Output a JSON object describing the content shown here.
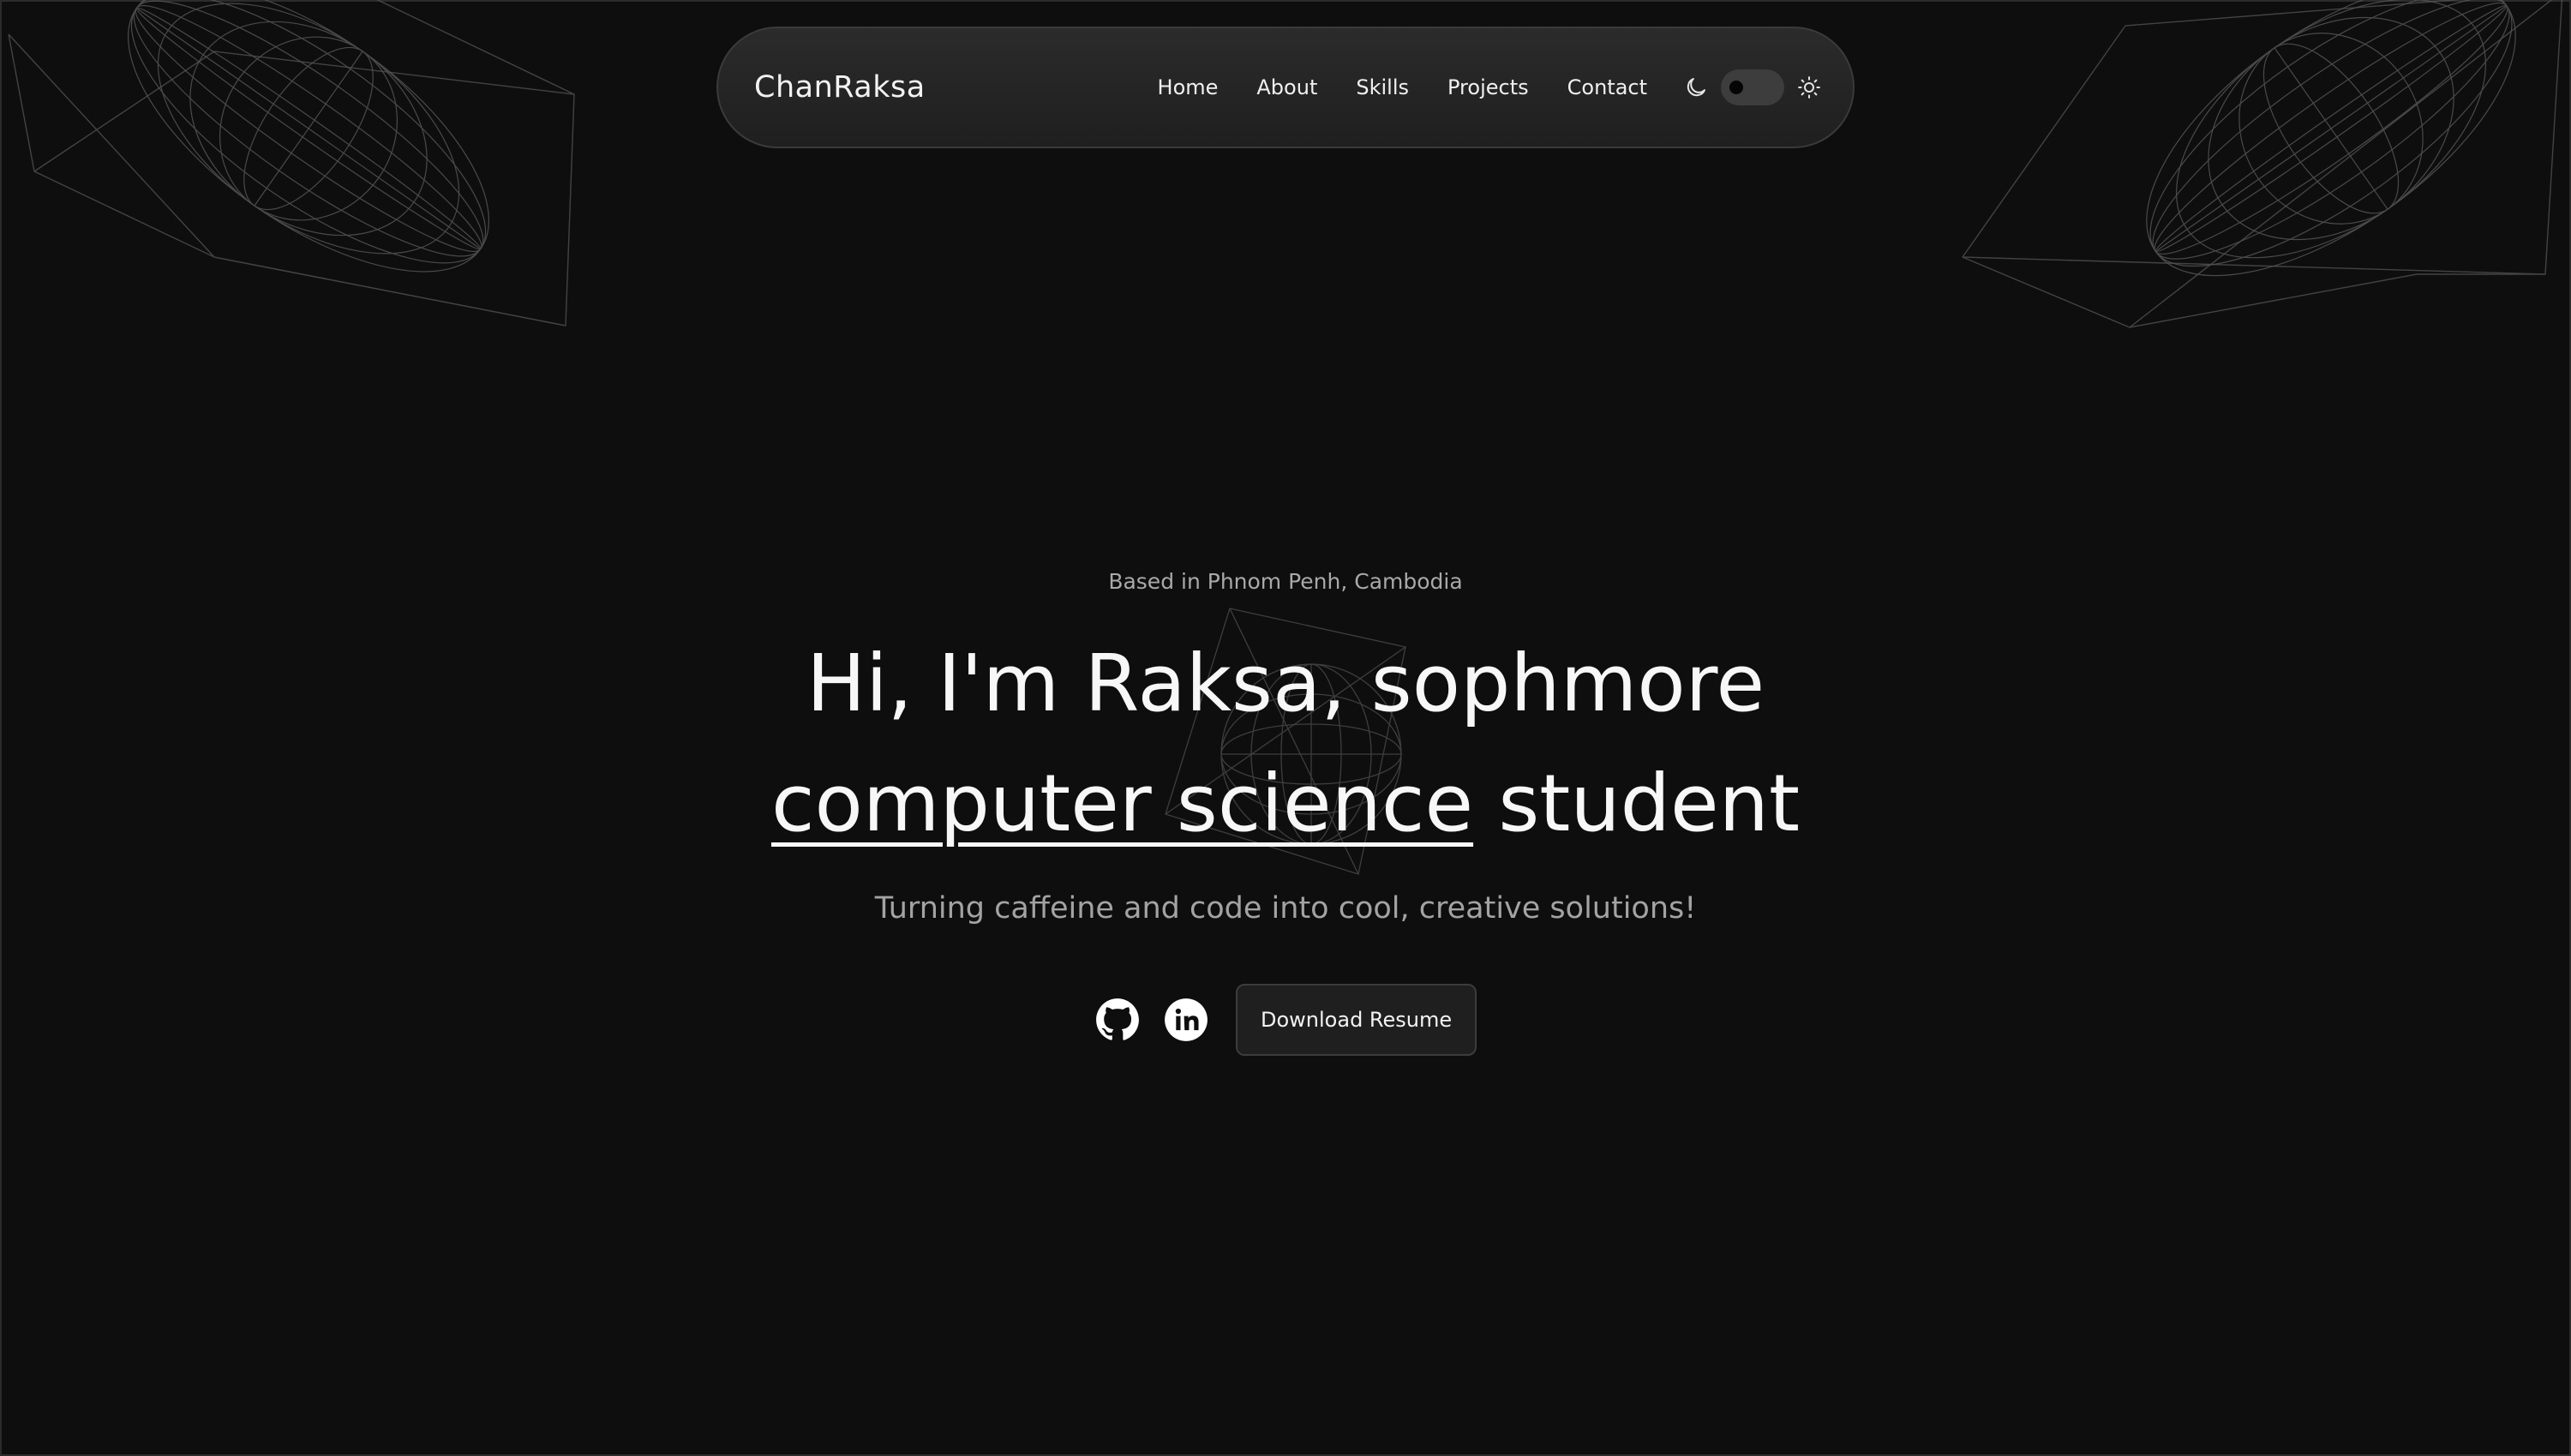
{
  "navbar": {
    "brand": "ChanRaksa",
    "links": [
      "Home",
      "About",
      "Skills",
      "Projects",
      "Contact"
    ],
    "theme": {
      "left_icon": "moon-icon",
      "right_icon": "sun-icon",
      "mode": "dark"
    }
  },
  "hero": {
    "location": "Based in Phnom Penh, Cambodia",
    "headline_line1": "Hi, I'm Raksa, sophmore",
    "headline_emphasis": "computer science",
    "headline_rest": " student",
    "tagline": "Turning caffeine and code into cool, creative solutions!",
    "socials": [
      {
        "icon": "github-icon"
      },
      {
        "icon": "linkedin-icon"
      }
    ],
    "resume_label": "Download Resume"
  },
  "colors": {
    "background": "#0e0e0e",
    "navbar_bg": "#252525",
    "text": "#ffffff",
    "muted_text": "#a3a3a3",
    "wireframe": "#5a5a5a"
  }
}
